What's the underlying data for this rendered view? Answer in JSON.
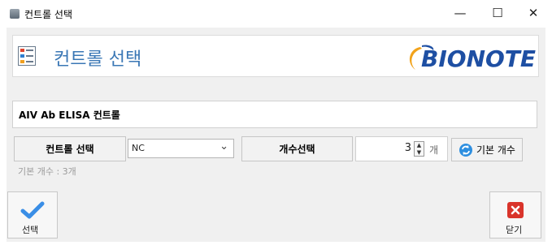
{
  "window": {
    "title": "컨트롤 선택",
    "min_glyph": "—",
    "max_glyph": "☐",
    "close_glyph": "✕"
  },
  "header": {
    "title": "컨트롤 선택",
    "logo_text": "BIONOTE",
    "logo_colors": {
      "text": "#1e4fa3",
      "swoosh": "#f2a31b"
    }
  },
  "info": {
    "text": "AIV Ab ELISA 컨트롤"
  },
  "controls": {
    "select_button_label": "컨트롤 선택",
    "control_select_value": "NC",
    "count_button_label": "개수선택",
    "count_value": "3",
    "count_unit": "개",
    "default_count_button_label": "기본 개수",
    "default_count_text": "기본 개수 : 3개"
  },
  "footer": {
    "select_label": "선택",
    "close_label": "닫기",
    "icons": {
      "select": "checkmark-icon",
      "close": "close-x-icon"
    },
    "colors": {
      "check": "#3a8ee6",
      "close": "#d9342b"
    }
  },
  "colors": {
    "header_title": "#3a77b5",
    "client_bg": "#f0f0f0"
  }
}
